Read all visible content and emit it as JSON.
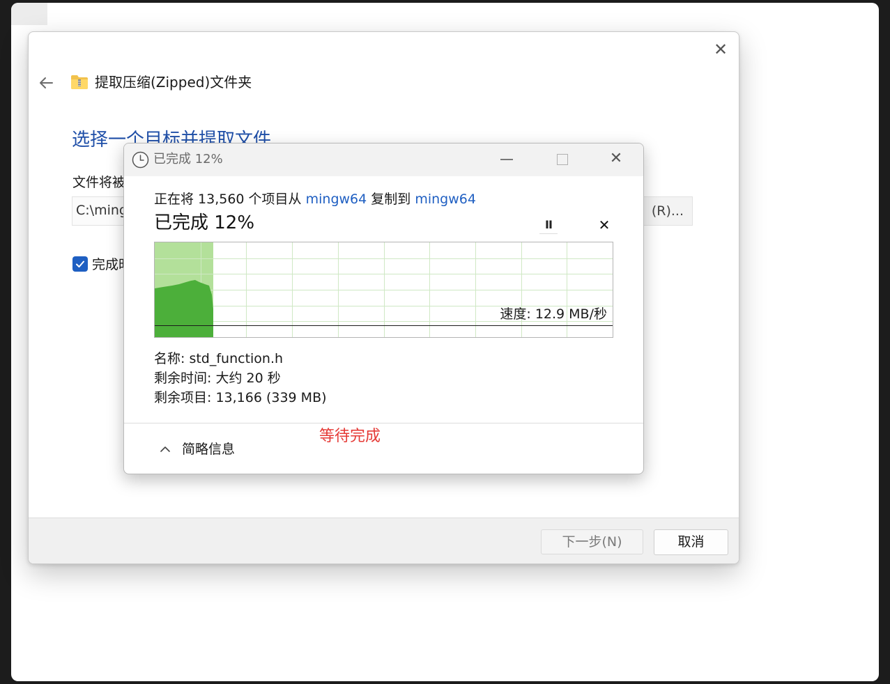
{
  "wizard": {
    "title": "提取压缩(Zipped)文件夹",
    "heading": "选择一个目标并提取文件",
    "dest_label": "文件将被",
    "dest_path": "C:\\ming",
    "browse_label": "(R)...",
    "show_when_done_label": "完成时",
    "show_when_done_checked": true,
    "next_label": "下一步(N)",
    "cancel_label": "取消",
    "close_icon": "close-icon"
  },
  "progress": {
    "window_title": "已完成 12%",
    "copy_prefix": "正在将 13,560 个项目从 ",
    "source": "mingw64",
    "copy_middle": " 复制到 ",
    "target": "mingw64",
    "percent_text": "已完成 12%",
    "percent_value": 12,
    "pause_glyph": "II",
    "stop_glyph": "✕",
    "speed_text": "速度: 12.9 MB/秒",
    "name_line": "名称: std_function.h",
    "time_line": "剩余时间: 大约 20 秒",
    "items_line": "剩余项目: 13,166 (339 MB)",
    "details_label": "简略信息",
    "waiting_note": "等待完成",
    "colors": {
      "graph_light": "#b3e09a",
      "graph_dark": "#4caf3a",
      "link": "#1f5fc2",
      "note": "#e53935"
    }
  }
}
